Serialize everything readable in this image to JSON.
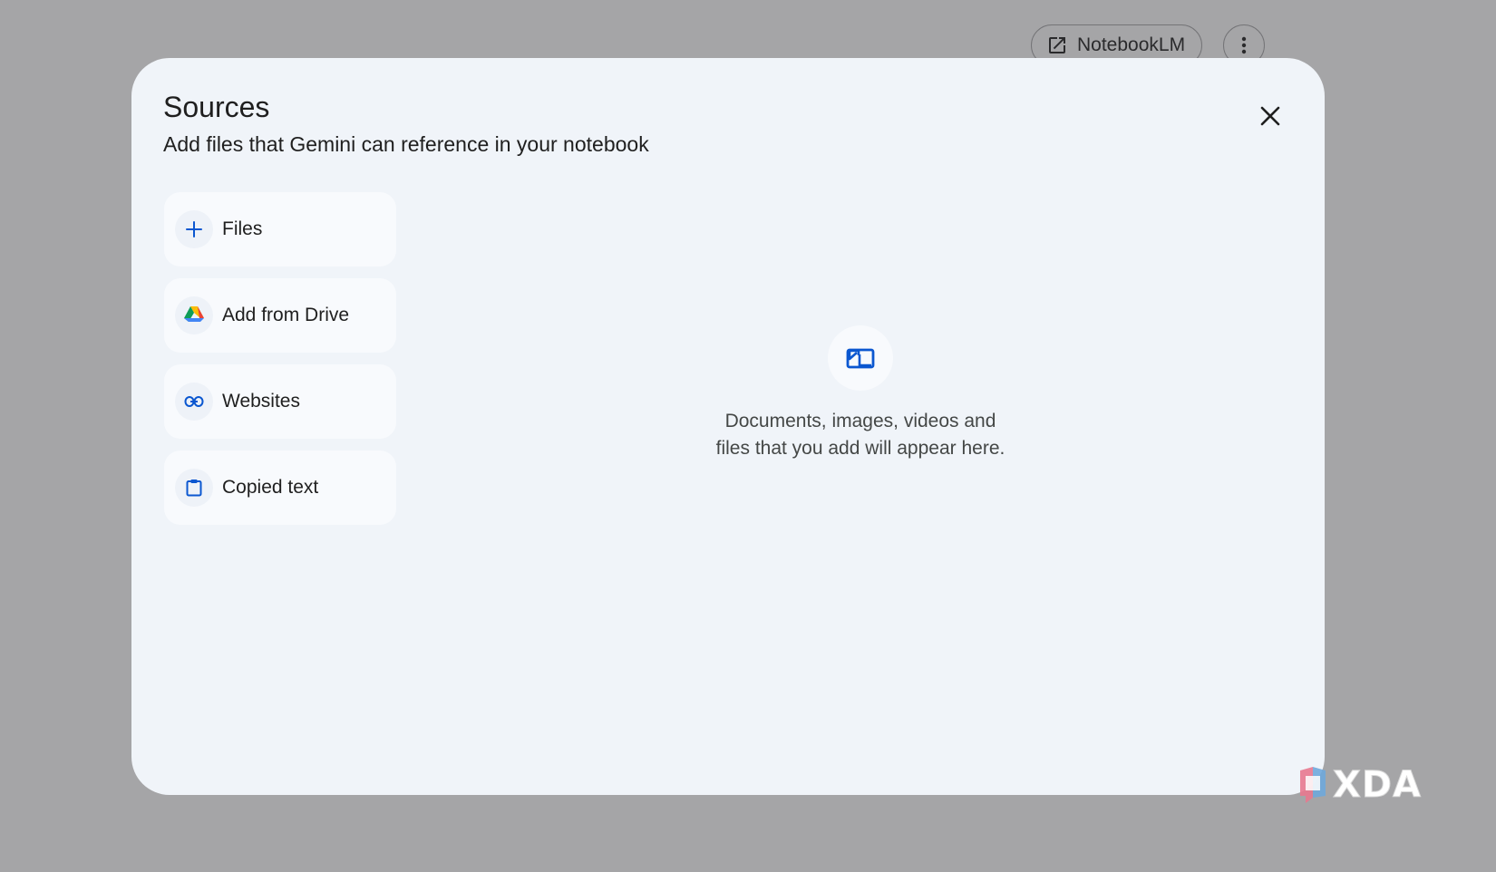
{
  "background_header": {
    "notebooklm_button_label": "NotebookLM",
    "notebooklm_icon": "open-in-new-icon",
    "more_icon": "more-vert-icon"
  },
  "dialog": {
    "title": "Sources",
    "subtitle": "Add files that Gemini can reference in your notebook",
    "close_icon": "close-icon",
    "source_options": [
      {
        "label": "Files",
        "icon": "plus-icon"
      },
      {
        "label": "Add from Drive",
        "icon": "google-drive-icon"
      },
      {
        "label": "Websites",
        "icon": "link-icon"
      },
      {
        "label": "Copied text",
        "icon": "clipboard-icon"
      }
    ],
    "empty_state": {
      "icon": "sources-icon",
      "line1": "Documents, images, videos and",
      "line2": "files that you add will appear here."
    }
  },
  "watermark": {
    "text": "XDA"
  },
  "colors": {
    "backdrop": "#a5a5a7",
    "dialog_bg": "#f0f4f9",
    "button_bg": "#f8fafd",
    "accent_blue": "#0b57d0"
  }
}
